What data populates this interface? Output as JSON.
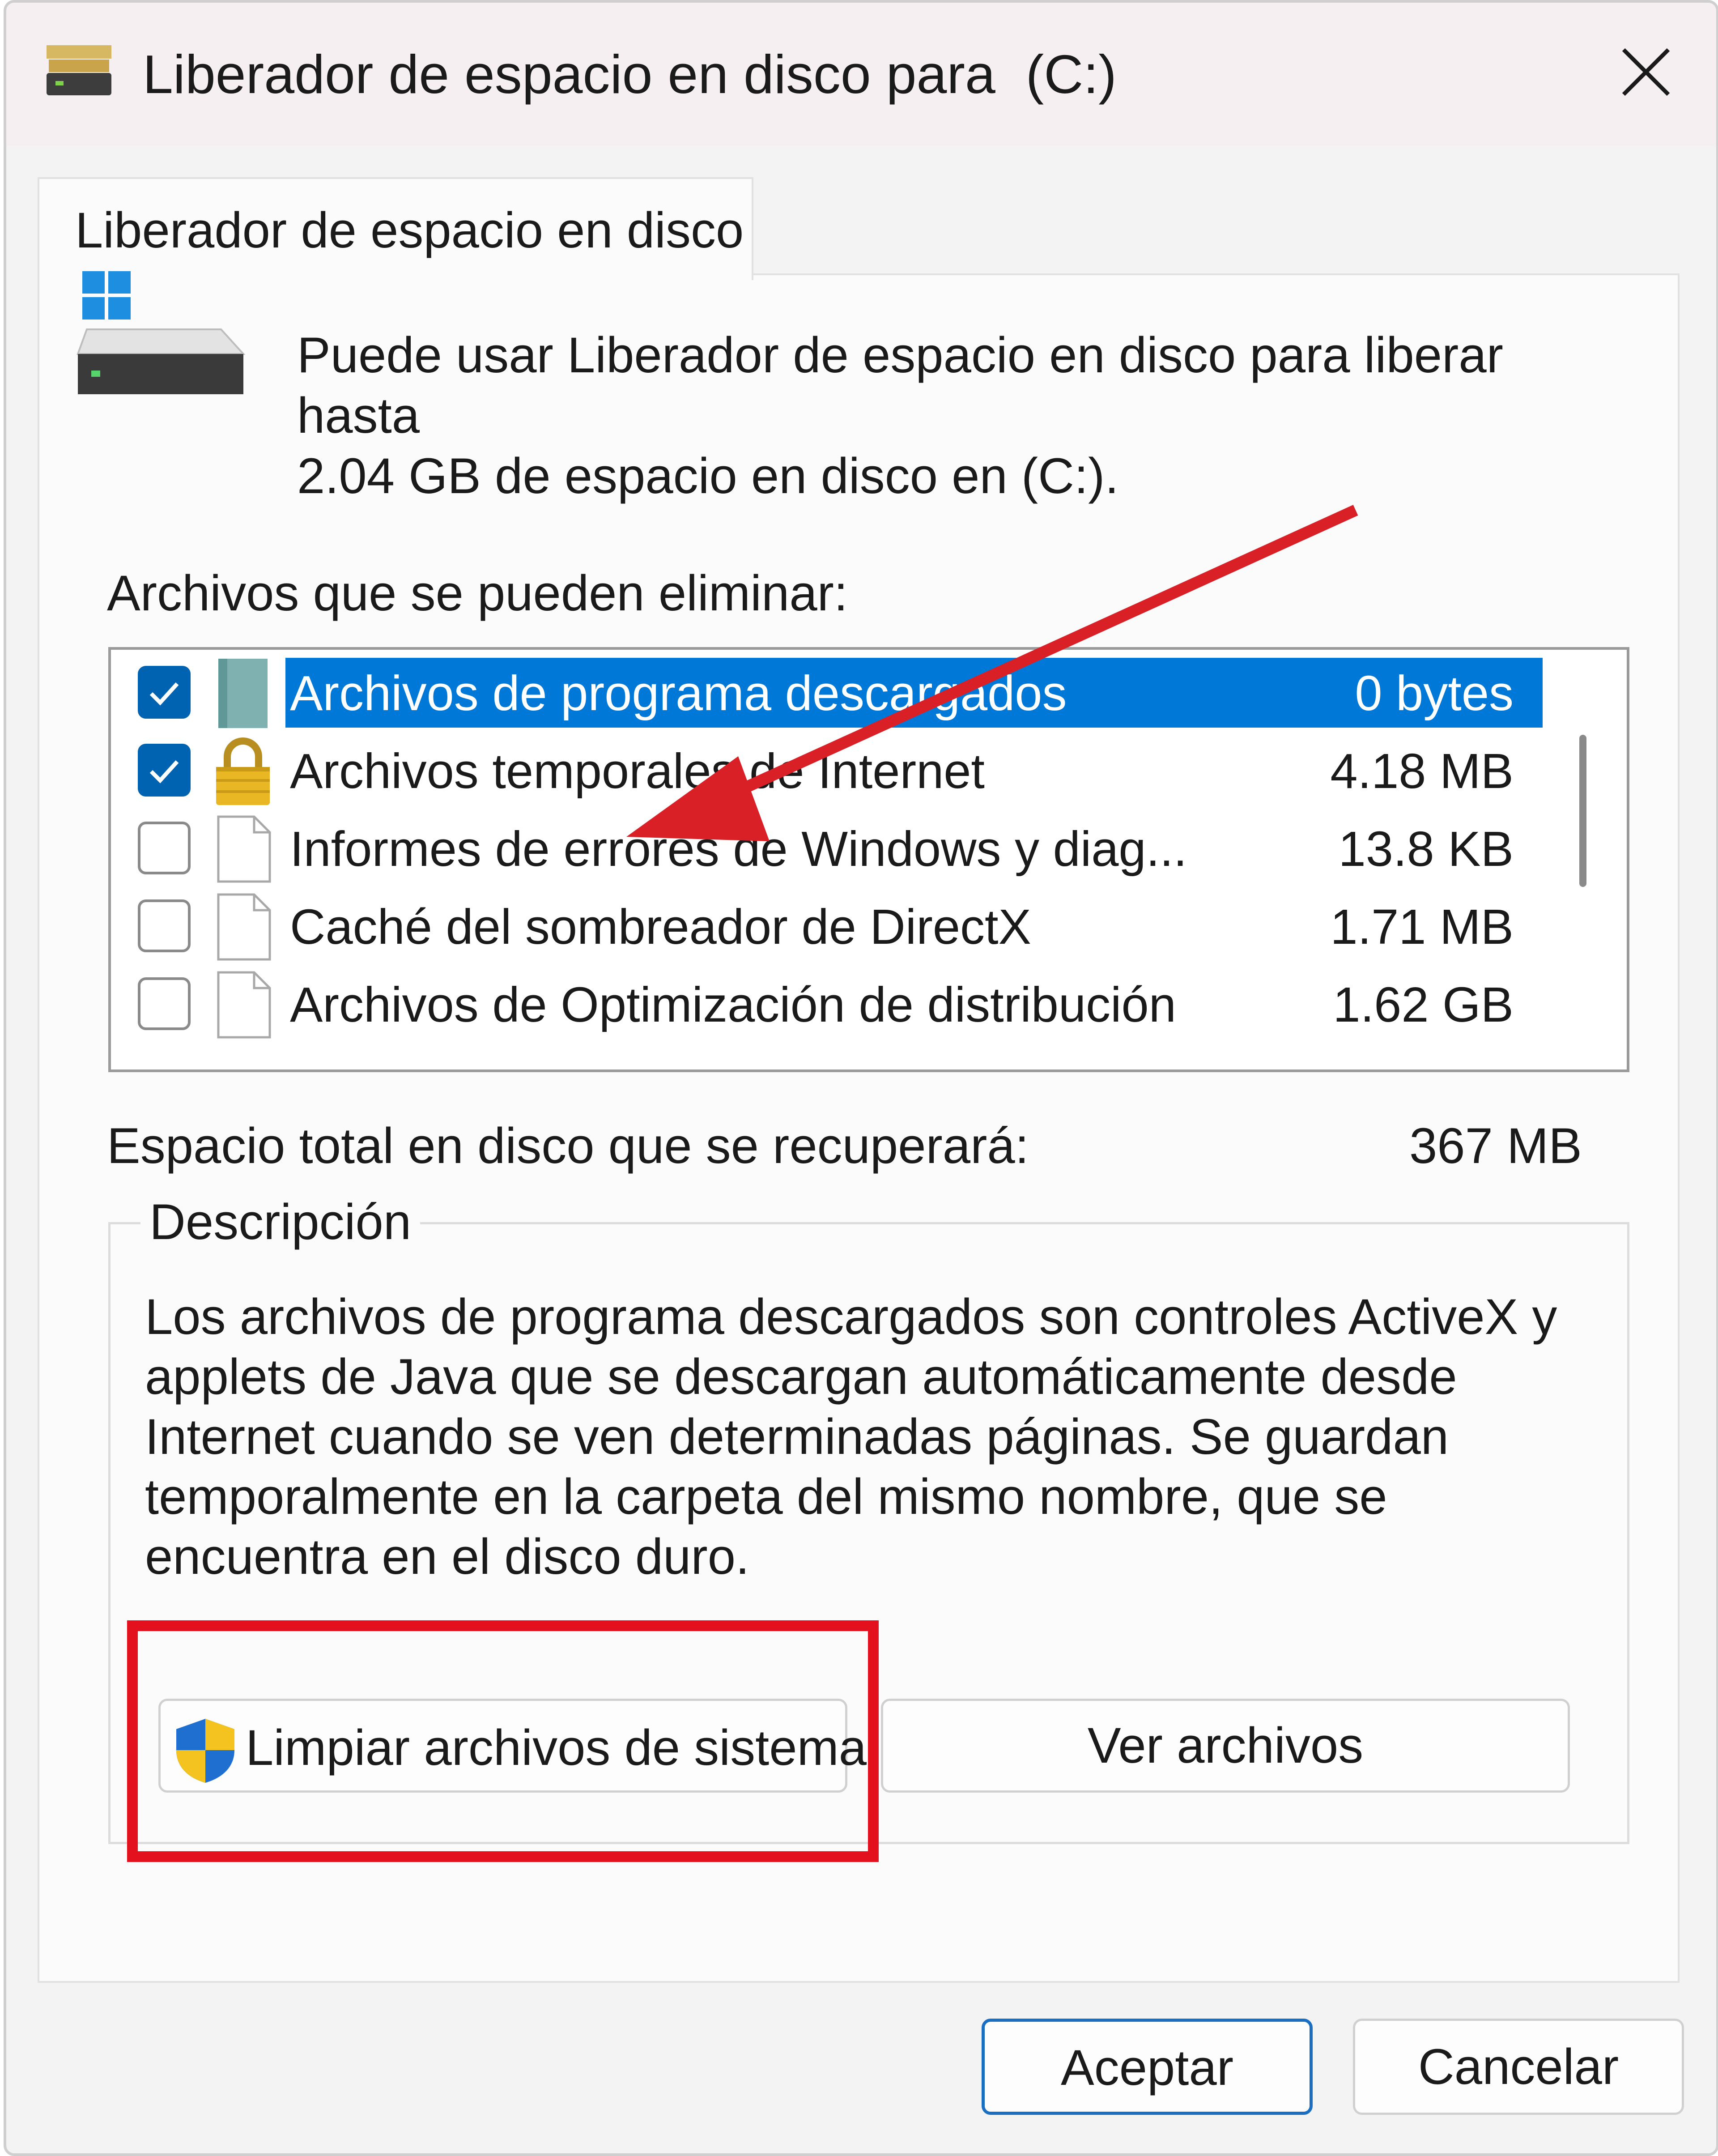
{
  "window": {
    "title": "Liberador de espacio en disco para  (C:)"
  },
  "tab": {
    "label": "Liberador de espacio en disco"
  },
  "intro": {
    "line1": "Puede usar Liberador de espacio en disco para liberar hasta",
    "line2": "2.04 GB de espacio en disco en  (C:)."
  },
  "files_section": {
    "label": "Archivos que se pueden eliminar:",
    "items": [
      {
        "name": "Archivos de programa descargados",
        "size": "0 bytes",
        "checked": true,
        "selected": true,
        "icon": "folder-icon"
      },
      {
        "name": "Archivos temporales de Internet",
        "size": "4.18 MB",
        "checked": true,
        "selected": false,
        "icon": "lock-icon"
      },
      {
        "name": "Informes de errores de Windows y diag...",
        "size": "13.8 KB",
        "checked": false,
        "selected": false,
        "icon": "document-icon"
      },
      {
        "name": "Caché del sombreador de DirectX",
        "size": "1.71 MB",
        "checked": false,
        "selected": false,
        "icon": "document-icon"
      },
      {
        "name": "Archivos de Optimización de distribución",
        "size": "1.62 GB",
        "checked": false,
        "selected": false,
        "icon": "document-icon"
      }
    ]
  },
  "total": {
    "label": "Espacio total en disco que se recuperará:",
    "value": "367 MB"
  },
  "description": {
    "legend": "Descripción",
    "text": "Los archivos de programa descargados son controles ActiveX y applets de Java que se descargan automáticamente desde Internet cuando se ven determinadas páginas. Se guardan temporalmente en la carpeta del mismo nombre, que se encuentra en el disco duro."
  },
  "buttons": {
    "clean_system": "Limpiar archivos de sistema",
    "view_files": "Ver archivos",
    "ok": "Aceptar",
    "cancel": "Cancelar"
  },
  "colors": {
    "selection": "#0078d7",
    "checkbox_checked": "#0063b1",
    "annotation_red": "#e3101e",
    "default_button_border": "#1a6fc2"
  }
}
